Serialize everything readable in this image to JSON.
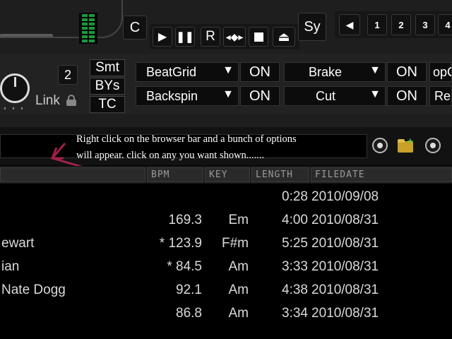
{
  "deck": {
    "cue_label": "C",
    "sync_label": "Sy",
    "rec_label": "R",
    "hotcues": [
      "1",
      "2",
      "3",
      "4"
    ],
    "pitch_range": "2",
    "link_label": "Link",
    "mode_buttons": [
      "Smt",
      "BYs",
      "TC"
    ],
    "effects": [
      {
        "name": "BeatGrid",
        "state": "ON"
      },
      {
        "name": "Brake",
        "state": "ON"
      },
      {
        "name": "Backspin",
        "state": "ON"
      },
      {
        "name": "Cut",
        "state": "ON"
      }
    ],
    "partial_right": [
      "opC",
      "Re"
    ]
  },
  "annotation": {
    "line1": "Right click on the browser bar and a bunch of options",
    "line2": "will appear. click on any you want shown......."
  },
  "columns": [
    "BPM",
    "KEY",
    "LENGTH",
    "FILEDATE"
  ],
  "rows": [
    {
      "title": "",
      "bpm": "",
      "key": "",
      "length": "0:28",
      "date": "2010/09/08"
    },
    {
      "title": "",
      "bpm": "169.3",
      "key": "Em",
      "length": "4:00",
      "date": "2010/08/31"
    },
    {
      "title": "ewart",
      "bpm": "* 123.9",
      "key": "F#m",
      "length": "5:25",
      "date": "2010/08/31"
    },
    {
      "title": "ian",
      "bpm": "* 84.5",
      "key": "Am",
      "length": "3:33",
      "date": "2010/08/31"
    },
    {
      "title": "Nate Dogg",
      "bpm": "92.1",
      "key": "Am",
      "length": "4:38",
      "date": "2010/08/31"
    },
    {
      "title": "",
      "bpm": "86.8",
      "key": "Am",
      "length": "3:34",
      "date": "2010/08/31"
    }
  ],
  "colors": {
    "annotation_arrow": "#a0204a",
    "level_meter": "#1a9a3a"
  }
}
